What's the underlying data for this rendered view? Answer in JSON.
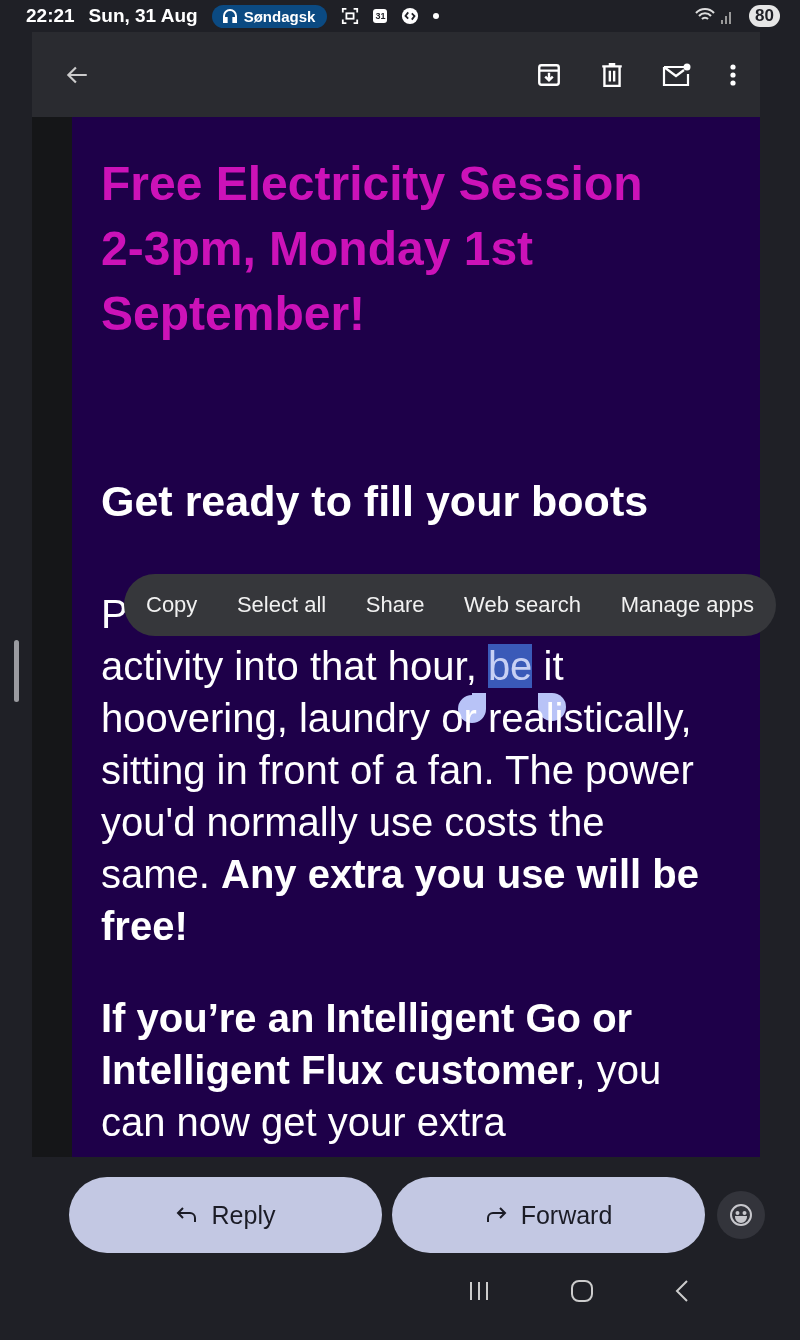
{
  "status_bar": {
    "time": "22:21",
    "date": "Sun, 31 Aug",
    "media_pill": "Søndagsk",
    "calendar_day": "31",
    "battery": "80"
  },
  "email": {
    "title": "Free Electricity Session 2-3pm, Monday 1st September!",
    "subheading": "Get ready to fill your boots",
    "paragraph_visible_start": "P",
    "paragraph_segments": [
      {
        "text": "activity into that hour, ",
        "selected": false
      },
      {
        "text": "be",
        "selected": true
      },
      {
        "text": " it hoovering, laundry or realistically, sitting in front of a fan. The power you'd normally use costs the same. **Any extra you use will be free!**",
        "selected": false
      }
    ],
    "paragraph_2": "**If you’re an Intelligent Go or Intelligent Flux customer**, you can now get your extra"
  },
  "context_menu": [
    "Copy",
    "Select all",
    "Share",
    "Web search",
    "Manage apps"
  ],
  "actions": [
    {
      "label": "Reply",
      "kind": "reply"
    },
    {
      "label": "Forward",
      "kind": "forward"
    }
  ]
}
